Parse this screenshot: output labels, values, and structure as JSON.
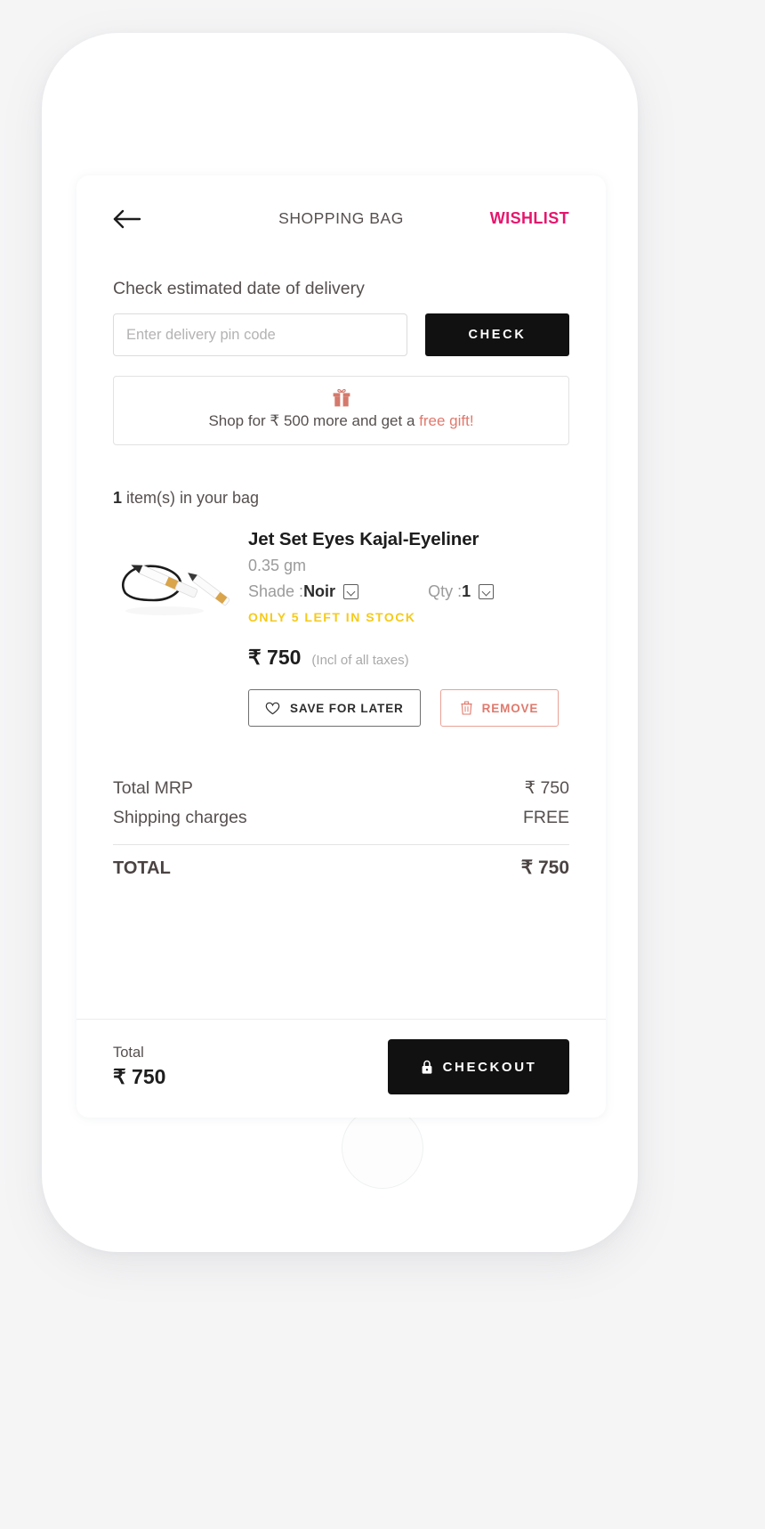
{
  "header": {
    "back_icon": "back-arrow-icon",
    "title": "SHOPPING BAG",
    "wishlist_label": "WISHLIST",
    "wishlist_color": "#e6156d"
  },
  "delivery": {
    "label": "Check estimated date of delivery",
    "pin_placeholder": "Enter delivery pin code",
    "pin_value": "",
    "check_label": "CHECK"
  },
  "gift_banner": {
    "icon": "gift-icon",
    "text_prefix": "Shop for ₹ 500 more and get a ",
    "text_highlight": "free gift!",
    "highlight_color": "#e0796c"
  },
  "bag": {
    "count": "1",
    "count_suffix": " item(s) in your bag"
  },
  "product": {
    "image_alt": "kajal-eyeliner-pencil",
    "name": "Jet Set Eyes Kajal-Eyeliner",
    "variant": "0.35 gm",
    "shade_label": "Shade : ",
    "shade_value": "Noir",
    "qty_label": "Qty : ",
    "qty_value": "1",
    "stock_warning": "ONLY 5 LEFT IN STOCK",
    "stock_color": "#f5ca1b",
    "price": "₹ 750",
    "price_note": "(Incl of all taxes)",
    "save_label": "SAVE FOR LATER",
    "remove_label": "REMOVE"
  },
  "summary": {
    "rows": [
      {
        "label": "Total MRP",
        "value": "₹ 750"
      },
      {
        "label": "Shipping charges",
        "value": "FREE"
      }
    ],
    "total_label": "TOTAL",
    "total_value": "₹ 750"
  },
  "bottom_bar": {
    "total_label": "Total",
    "total_amount": "₹ 750",
    "checkout_label": "CHECKOUT",
    "lock_icon": "lock-icon"
  }
}
